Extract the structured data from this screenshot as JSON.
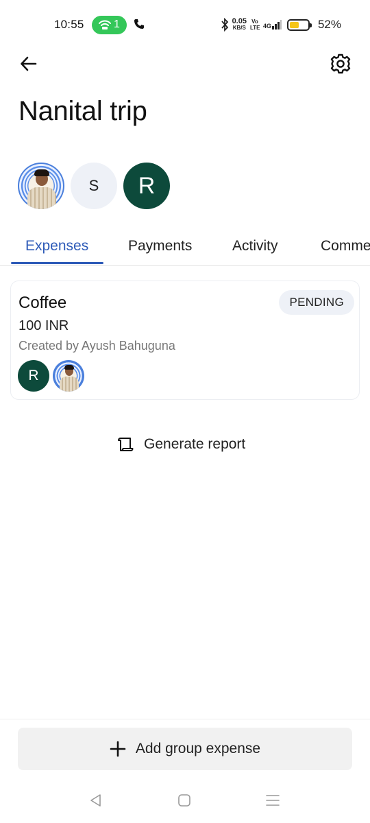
{
  "status_bar": {
    "time": "10:55",
    "hotspot_count": "1",
    "net_speed": "0.05",
    "net_speed_unit": "KB/S",
    "volte": "Vo LTE",
    "signal": "4G",
    "battery_level": 0.52,
    "battery_pct": "52%"
  },
  "header": {
    "title": "Nanital trip",
    "back_icon": "arrow-left-icon",
    "settings_icon": "gear-icon"
  },
  "members": [
    {
      "type": "photo"
    },
    {
      "initial": "S"
    },
    {
      "initial": "R"
    }
  ],
  "tabs": [
    {
      "label": "Expenses",
      "active": true
    },
    {
      "label": "Payments",
      "active": false
    },
    {
      "label": "Activity",
      "active": false
    },
    {
      "label": "Comments",
      "active": false
    }
  ],
  "expense": {
    "title": "Coffee",
    "status": "PENDING",
    "amount": "100 INR",
    "created_by": "Created by Ayush Bahuguna",
    "participants": [
      "R",
      "photo"
    ]
  },
  "report": {
    "label": "Generate report",
    "icon": "scroll-icon"
  },
  "add_button": {
    "label": "Add group expense",
    "icon": "plus-icon"
  },
  "colors": {
    "accent": "#2e5bb8",
    "avatar_green": "#0d4a3b",
    "hotspot_green": "#34c759",
    "battery_yellow": "#f5c518"
  }
}
